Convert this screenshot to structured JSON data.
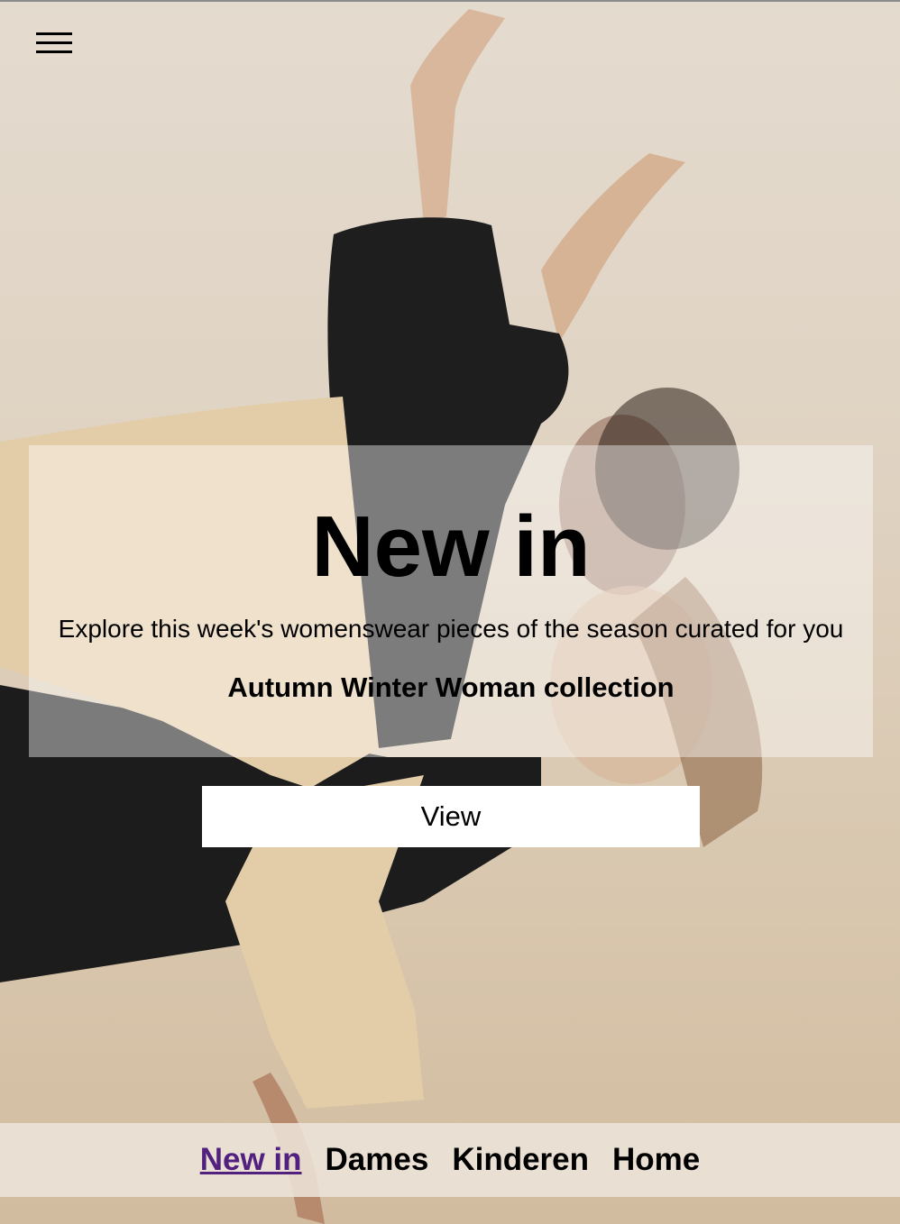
{
  "menu": {
    "icon": "hamburger-menu-icon"
  },
  "hero": {
    "title": "New in",
    "subtitle": "Explore this week's womenswear pieces of the season curated for you",
    "collection": "Autumn Winter Woman collection",
    "button_label": "View"
  },
  "bottom_nav": {
    "items": [
      {
        "label": "New in",
        "active": true
      },
      {
        "label": "Dames"
      },
      {
        "label": "Kinderen"
      },
      {
        "label": "Home"
      }
    ]
  },
  "colors": {
    "visited_link": "#52217f",
    "text": "#000000",
    "button_bg": "#ffffff"
  }
}
